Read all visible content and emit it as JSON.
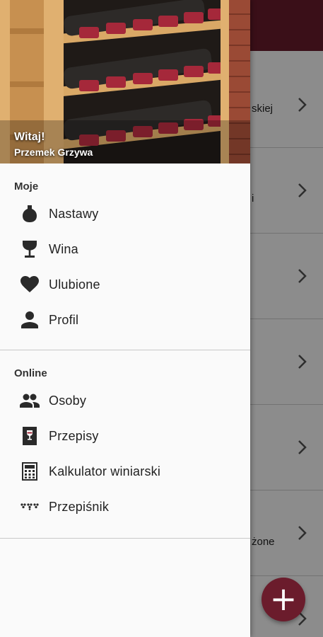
{
  "background": {
    "row_texts": [
      "skiej",
      "i",
      "",
      "",
      "",
      "żone",
      ""
    ]
  },
  "drawer": {
    "header": {
      "greeting": "Witaj!",
      "user_name": "Przemek Grzywa"
    },
    "sections": [
      {
        "title": "Moje",
        "items": [
          {
            "label": "Nastawy",
            "icon": "carboy-icon"
          },
          {
            "label": "Wina",
            "icon": "wine-glass-icon"
          },
          {
            "label": "Ulubione",
            "icon": "heart-icon"
          },
          {
            "label": "Profil",
            "icon": "person-icon"
          }
        ]
      },
      {
        "title": "Online",
        "items": [
          {
            "label": "Osoby",
            "icon": "people-icon"
          },
          {
            "label": "Przepisy",
            "icon": "recipe-glass-icon"
          },
          {
            "label": "Kalkulator winiarski",
            "icon": "calculator-icon"
          },
          {
            "label": "Przepiśnik",
            "icon": "grapes-icon"
          }
        ]
      }
    ]
  },
  "fab": {
    "icon": "plus-icon",
    "glyph": "+"
  },
  "colors": {
    "accent": "#6b1c2c",
    "drawer_bg": "#fafafa",
    "icon": "#2a2a2a"
  }
}
